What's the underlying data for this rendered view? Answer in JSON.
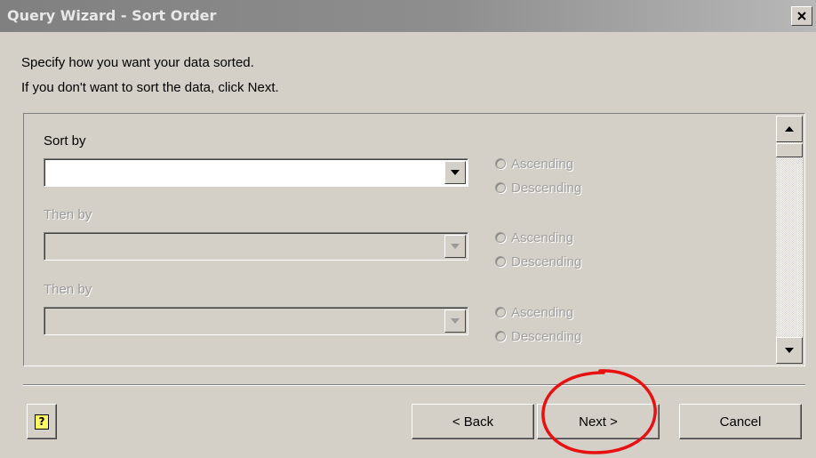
{
  "window": {
    "title": "Query Wizard - Sort Order",
    "close_glyph": "×"
  },
  "instructions": {
    "line1": "Specify how you want your data sorted.",
    "line2": "If you don't want to sort the data, click Next."
  },
  "sort_fields": [
    {
      "label": "Sort by",
      "value": "",
      "enabled": true,
      "ascending_label": "Ascending",
      "descending_label": "Descending"
    },
    {
      "label": "Then by",
      "value": "",
      "enabled": false,
      "ascending_label": "Ascending",
      "descending_label": "Descending"
    },
    {
      "label": "Then by",
      "value": "",
      "enabled": false,
      "ascending_label": "Ascending",
      "descending_label": "Descending"
    }
  ],
  "buttons": {
    "help_glyph": "?",
    "back_label": "< Back",
    "next_label": "Next >",
    "cancel_label": "Cancel"
  },
  "icons": {
    "close": "close-icon",
    "dropdown": "chevron-down-icon",
    "scroll_up": "scroll-up-arrow-icon",
    "scroll_down": "scroll-down-arrow-icon",
    "help": "help-icon"
  },
  "colors": {
    "dialog_bg": "#d4d0c8",
    "titlebar_inactive": "#808080",
    "annotation": "#e81010"
  }
}
